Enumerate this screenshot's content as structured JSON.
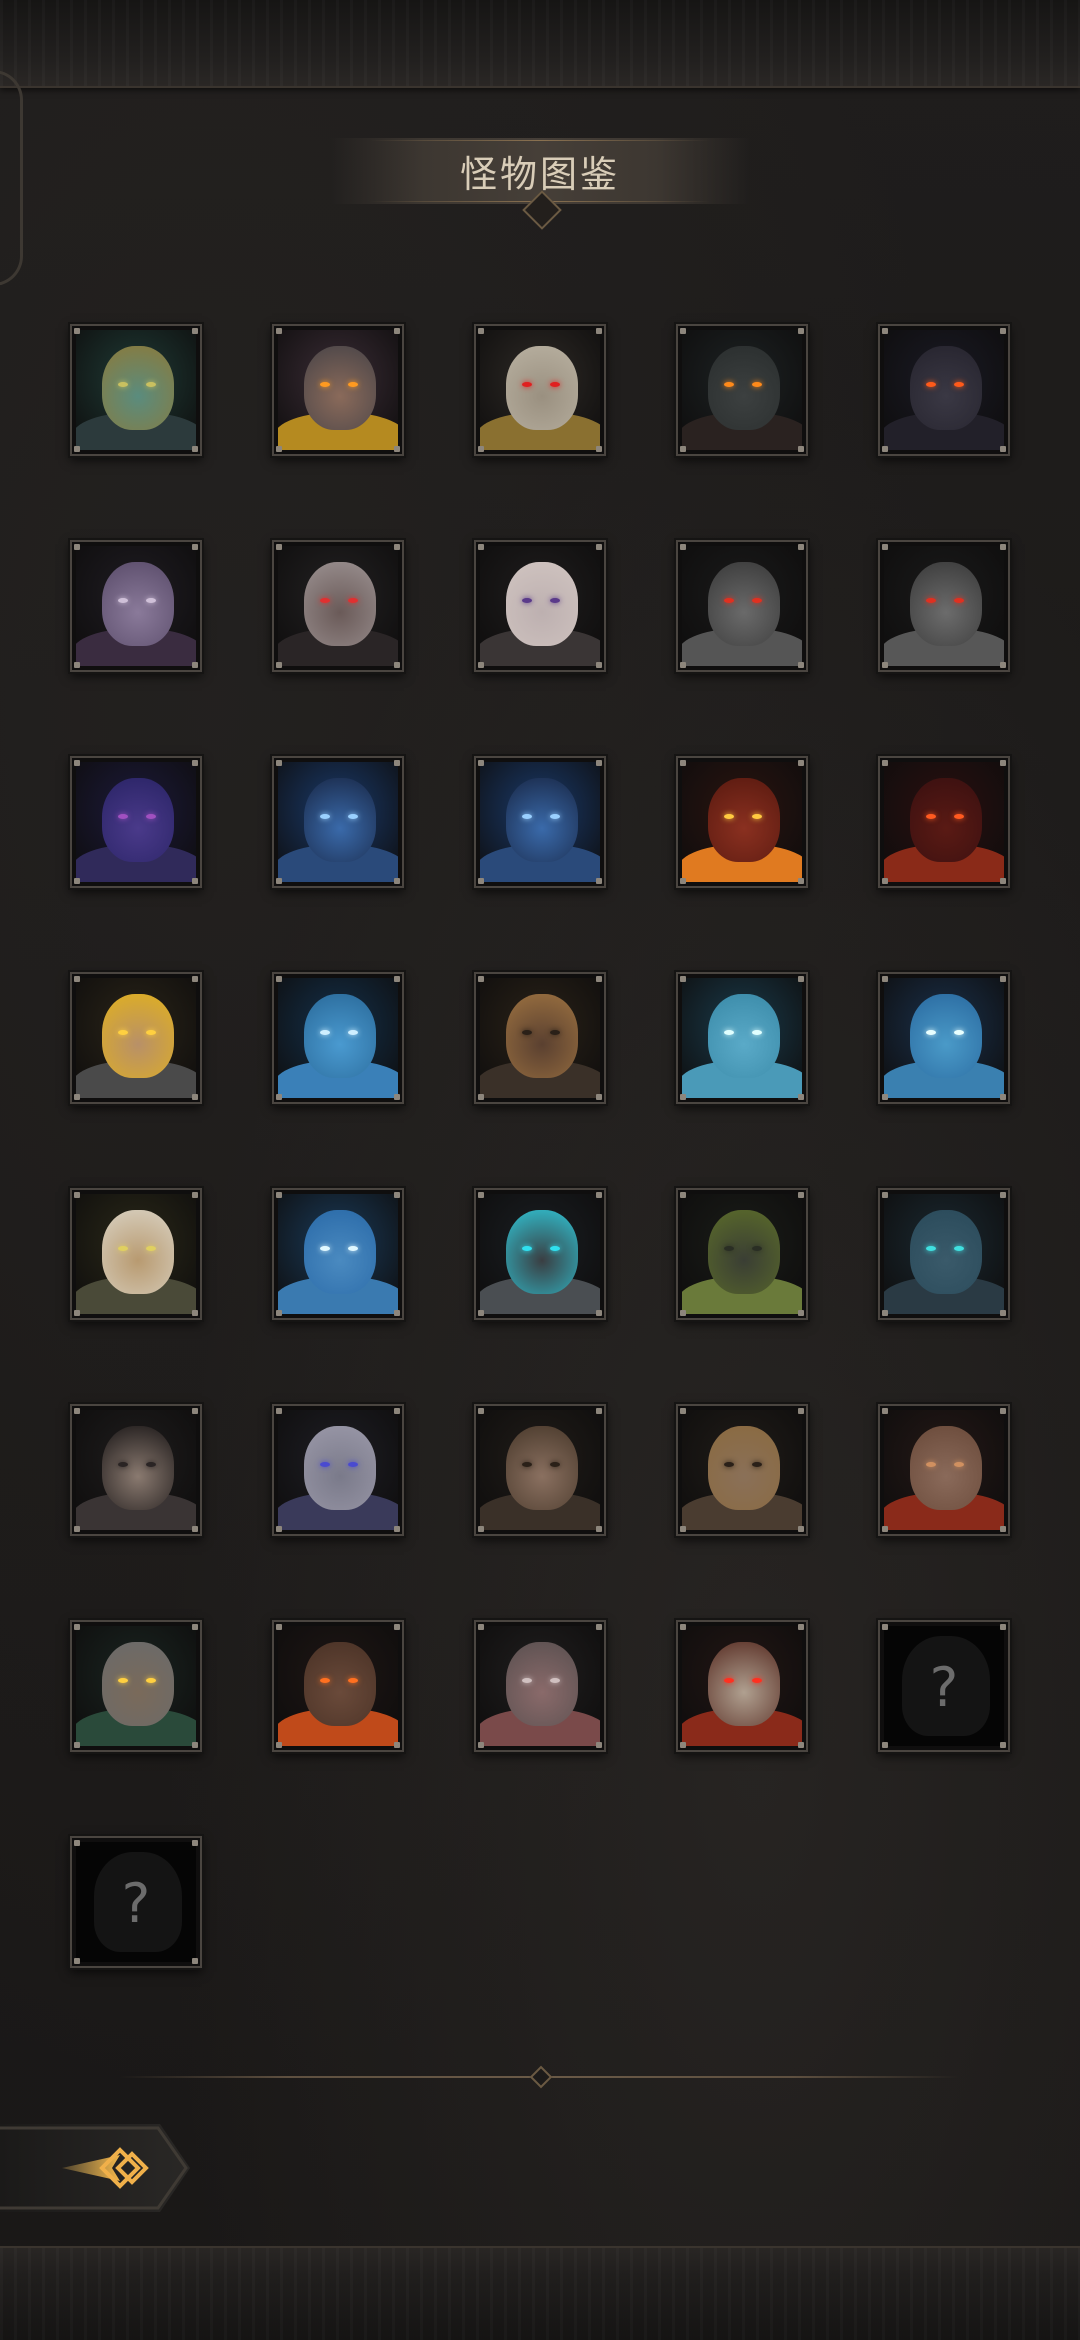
{
  "title": "怪物图鉴",
  "colors": {
    "accent_gold": "#e7a53a",
    "frame": "#4a4540",
    "background": "#1c1a19"
  },
  "back_button": {
    "icon": "back-arrow-icon"
  },
  "monsters": [
    {
      "name": "monster-1",
      "known": true,
      "bg": "#1f3a35",
      "skin": "#5a8c7e",
      "hair": "#8a7a3c",
      "cloth": "#2c3a3c",
      "eyes": "#c9c060"
    },
    {
      "name": "monster-2",
      "known": true,
      "bg": "#3a2c35",
      "skin": "#8a6a5a",
      "hair": "#4a4548",
      "cloth": "#b58a20",
      "eyes": "#ff9a20"
    },
    {
      "name": "monster-3",
      "known": true,
      "bg": "#2e2a26",
      "skin": "#9a9080",
      "hair": "#b8b0a0",
      "cloth": "#8a7030",
      "eyes": "#e02020"
    },
    {
      "name": "monster-4",
      "known": true,
      "bg": "#1d2223",
      "skin": "#3c4040",
      "hair": "#2a2e2e",
      "cloth": "#2a2220",
      "eyes": "#ff8a1a"
    },
    {
      "name": "monster-5",
      "known": true,
      "bg": "#1a1a24",
      "skin": "#3a3844",
      "hair": "#26242e",
      "cloth": "#222029",
      "eyes": "#ff5a1a"
    },
    {
      "name": "monster-6",
      "known": true,
      "bg": "#1f1c22",
      "skin": "#8a7a9a",
      "hair": "#5a4c6a",
      "cloth": "#3a2c40",
      "eyes": "#cfc0d8"
    },
    {
      "name": "monster-7",
      "known": true,
      "bg": "#232122",
      "skin": "#6a5a58",
      "hair": "#9a9090",
      "cloth": "#2a2526",
      "eyes": "#e03030"
    },
    {
      "name": "monster-8",
      "known": true,
      "bg": "#1f1d1d",
      "skin": "#bdb0b0",
      "hair": "#d0c4c0",
      "cloth": "#3a3535",
      "eyes": "#5a3a8a"
    },
    {
      "name": "monster-9",
      "known": true,
      "bg": "#1a1a1a",
      "skin": "#6a6a6a",
      "hair": "#3a3a3a",
      "cloth": "#555555",
      "eyes": "#e03020"
    },
    {
      "name": "monster-10",
      "known": true,
      "bg": "#1a1a1a",
      "skin": "#6c6c6c",
      "hair": "#3a3a3a",
      "cloth": "#575757",
      "eyes": "#e03020"
    },
    {
      "name": "monster-11",
      "known": true,
      "bg": "#1c1a3a",
      "skin": "#4a3a8a",
      "hair": "#2a2466",
      "cloth": "#302a5a",
      "eyes": "#a050c0"
    },
    {
      "name": "monster-12",
      "known": true,
      "bg": "#1a3a6a",
      "skin": "#3a6aaa",
      "hair": "#1a2a4a",
      "cloth": "#2a4a7a",
      "eyes": "#9ad0ff"
    },
    {
      "name": "monster-13",
      "known": true,
      "bg": "#1a3a6a",
      "skin": "#3a6aaa",
      "hair": "#1a2a4a",
      "cloth": "#2a4a7a",
      "eyes": "#9ad0ff"
    },
    {
      "name": "monster-14",
      "known": true,
      "bg": "#2a1410",
      "skin": "#8a3020",
      "hair": "#5a1a10",
      "cloth": "#e07a20",
      "eyes": "#ffca40"
    },
    {
      "name": "monster-15",
      "known": true,
      "bg": "#2a1010",
      "skin": "#5a1a14",
      "hair": "#3a1010",
      "cloth": "#8a2a18",
      "eyes": "#ff5a20"
    },
    {
      "name": "monster-16",
      "known": true,
      "bg": "#2a2418",
      "skin": "#b89068",
      "hair": "#e0b020",
      "cloth": "#4a4a4a",
      "eyes": "#ffd040"
    },
    {
      "name": "monster-17",
      "known": true,
      "bg": "#14304a",
      "skin": "#4a9ad0",
      "hair": "#2a6a9a",
      "cloth": "#3a80b8",
      "eyes": "#cfefff"
    },
    {
      "name": "monster-18",
      "known": true,
      "bg": "#2a2218",
      "skin": "#5a4030",
      "hair": "#9a7040",
      "cloth": "#3a3028",
      "eyes": "#2a2018"
    },
    {
      "name": "monster-19",
      "known": true,
      "bg": "#1a3a4a",
      "skin": "#5aaac8",
      "hair": "#3a8aa8",
      "cloth": "#4a9ab8",
      "eyes": "#e0ffff"
    },
    {
      "name": "monster-20",
      "known": true,
      "bg": "#1a304a",
      "skin": "#4a9ac8",
      "hair": "#2a6aa0",
      "cloth": "#3a80b0",
      "eyes": "#e8ffff"
    },
    {
      "name": "monster-21",
      "known": true,
      "bg": "#2a2818",
      "skin": "#b89a70",
      "hair": "#d8d0c0",
      "cloth": "#4a4a38",
      "eyes": "#e0d060"
    },
    {
      "name": "monster-22",
      "known": true,
      "bg": "#1a3a58",
      "skin": "#4a8ac0",
      "hair": "#2a6aa8",
      "cloth": "#3a7ab0",
      "eyes": "#e0f8ff"
    },
    {
      "name": "monster-23",
      "known": true,
      "bg": "#1a1e22",
      "skin": "#3a3e42",
      "hair": "#30c0d0",
      "cloth": "#4a4e52",
      "eyes": "#30e0f0"
    },
    {
      "name": "monster-24",
      "known": true,
      "bg": "#1a1c18",
      "skin": "#3a3e34",
      "hair": "#5a6a2a",
      "cloth": "#6a7a3a",
      "eyes": "#2a2e24"
    },
    {
      "name": "monster-25",
      "known": true,
      "bg": "#1a2830",
      "skin": "#3a5a6a",
      "hair": "#2a4a5a",
      "cloth": "#2a3a44",
      "eyes": "#40e0e0"
    },
    {
      "name": "monster-26",
      "known": true,
      "bg": "#1e1c1c",
      "skin": "#8a7a70",
      "hair": "#1e1a1a",
      "cloth": "#3a3434",
      "eyes": "#2a2424"
    },
    {
      "name": "monster-27",
      "known": true,
      "bg": "#1e1e24",
      "skin": "#7a7a8a",
      "hair": "#9a98a8",
      "cloth": "#3a3a5a",
      "eyes": "#4a4ad0"
    },
    {
      "name": "monster-28",
      "known": true,
      "bg": "#201c18",
      "skin": "#8a7060",
      "hair": "#4a3a2c",
      "cloth": "#3a3028",
      "eyes": "#2a2018"
    },
    {
      "name": "monster-29",
      "known": true,
      "bg": "#201c18",
      "skin": "#8a7058",
      "hair": "#8a6a40",
      "cloth": "#4a3c30",
      "eyes": "#2a2018"
    },
    {
      "name": "monster-30",
      "known": true,
      "bg": "#241816",
      "skin": "#8a6a5a",
      "hair": "#6a4a3a",
      "cloth": "#8a2a1a",
      "eyes": "#d09060"
    },
    {
      "name": "monster-31",
      "known": true,
      "bg": "#1a2420",
      "skin": "#7a6a5a",
      "hair": "#6a6a6a",
      "cloth": "#2a4a3a",
      "eyes": "#ffd040"
    },
    {
      "name": "monster-32",
      "known": true,
      "bg": "#1e1614",
      "skin": "#6a4a3a",
      "hair": "#4a3226",
      "cloth": "#c04a1a",
      "eyes": "#ff7020"
    },
    {
      "name": "monster-33",
      "known": true,
      "bg": "#201e1e",
      "skin": "#8a6a6a",
      "hair": "#5a5050",
      "cloth": "#7a4a4a",
      "eyes": "#d0c0c0"
    },
    {
      "name": "monster-34",
      "known": true,
      "bg": "#221614",
      "skin": "#b0a090",
      "hair": "#5a3026",
      "cloth": "#8a2a1a",
      "eyes": "#ff3020"
    },
    {
      "name": "monster-35",
      "known": false,
      "label": "?"
    },
    {
      "name": "monster-36",
      "known": false,
      "label": "?"
    }
  ]
}
